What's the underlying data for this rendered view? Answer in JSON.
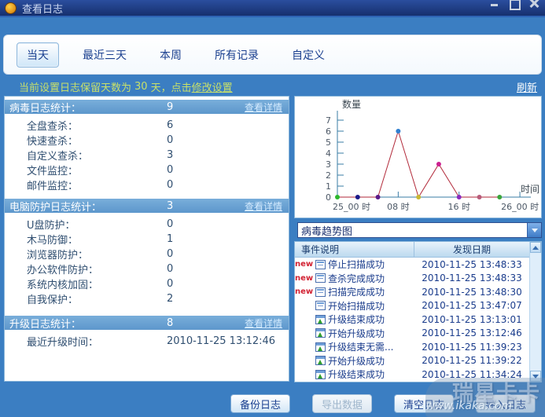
{
  "window": {
    "title": "查看日志"
  },
  "tabs": {
    "items": [
      {
        "label": "当天",
        "active": true
      },
      {
        "label": "最近三天",
        "active": false
      },
      {
        "label": "本周",
        "active": false
      },
      {
        "label": "所有记录",
        "active": false
      },
      {
        "label": "自定义",
        "active": false
      }
    ]
  },
  "notice": {
    "prefix": "当前设置日志保留天数为",
    "days": "30",
    "suffix": "天，点击",
    "link": "修改设置",
    "refresh": "刷新"
  },
  "stats": {
    "sections": [
      {
        "title": "病毒日志统计：",
        "total": "9",
        "detail_link": "查看详情",
        "rows": [
          {
            "label": "全盘查杀：",
            "value": "6"
          },
          {
            "label": "快速查杀：",
            "value": "0"
          },
          {
            "label": "自定义查杀：",
            "value": "3"
          },
          {
            "label": "文件监控：",
            "value": "0"
          },
          {
            "label": "邮件监控：",
            "value": "0"
          }
        ]
      },
      {
        "title": "电脑防护日志统计：",
        "total": "3",
        "detail_link": "查看详情",
        "rows": [
          {
            "label": "U盘防护：",
            "value": "0"
          },
          {
            "label": "木马防御：",
            "value": "1"
          },
          {
            "label": "浏览器防护：",
            "value": "0"
          },
          {
            "label": "办公软件防护：",
            "value": "0"
          },
          {
            "label": "系统内核加固：",
            "value": "0"
          },
          {
            "label": "自我保护：",
            "value": "2"
          }
        ]
      },
      {
        "title": "升级日志统计：",
        "total": "8",
        "detail_link": "查看详情",
        "rows": [
          {
            "label": "最近升级时间：",
            "value": "2010-11-25 13:12:46"
          }
        ]
      }
    ]
  },
  "chart_data": {
    "type": "line",
    "title": "病毒趋势图",
    "xlabel": "时间",
    "ylabel": "数量",
    "ylim": [
      0,
      7
    ],
    "y_ticks": [
      0,
      1,
      2,
      3,
      4,
      5,
      6,
      7
    ],
    "x_tick_hours": [
      0,
      8,
      16,
      24
    ],
    "x_tick_labels": [
      "25_00 时",
      "08 时",
      "16 时",
      "26_00 时"
    ],
    "x_hours": [
      0,
      2.67,
      5.33,
      8,
      10.67,
      13.33,
      16,
      18.67,
      21.33
    ],
    "values": [
      0,
      0,
      0,
      6,
      0,
      3,
      0,
      0,
      0
    ],
    "point_colors": [
      "#2db82d",
      "#1b1b8a",
      "#5a1b8a",
      "#2f7fd0",
      "#c9b832",
      "#cc2090",
      "#8a2bbf",
      "#b85c7a",
      "#3aa53a"
    ],
    "line_color": "#b22a3a",
    "axis_color": "#3a7ca5",
    "grid": false,
    "legend": "none"
  },
  "trend_select": {
    "value": "病毒趋势图"
  },
  "events_table": {
    "headers": [
      "事件说明",
      "发现日期"
    ],
    "new_label": "new",
    "rows": [
      {
        "is_new": true,
        "icon": "log-icon",
        "text": "停止扫描成功",
        "date": "2010-11-25 13:48:33"
      },
      {
        "is_new": true,
        "icon": "log-icon",
        "text": "查杀完成成功",
        "date": "2010-11-25 13:48:33"
      },
      {
        "is_new": true,
        "icon": "log-icon",
        "text": "扫描完成成功",
        "date": "2010-11-25 13:48:30"
      },
      {
        "is_new": false,
        "icon": "log-icon",
        "text": "开始扫描成功",
        "date": "2010-11-25 13:47:07"
      },
      {
        "is_new": false,
        "icon": "upgrade-icon",
        "text": "升级结束成功",
        "date": "2010-11-25 13:13:01"
      },
      {
        "is_new": false,
        "icon": "upgrade-icon",
        "text": "开始升级成功",
        "date": "2010-11-25 13:12:46"
      },
      {
        "is_new": false,
        "icon": "upgrade-icon",
        "text": "升级结束无需...",
        "date": "2010-11-25 11:39:23"
      },
      {
        "is_new": false,
        "icon": "upgrade-icon",
        "text": "开始升级成功",
        "date": "2010-11-25 11:39:22"
      },
      {
        "is_new": false,
        "icon": "upgrade-icon",
        "text": "升级结束成功",
        "date": "2010-11-25 11:34:24"
      }
    ]
  },
  "footer": {
    "buttons": [
      {
        "label": "备份日志",
        "enabled": true
      },
      {
        "label": "导出数据",
        "enabled": false
      },
      {
        "label": "清空日志",
        "enabled": true
      },
      {
        "label": "导入日志",
        "enabled": true
      }
    ]
  },
  "watermark": {
    "brand": "瑞星卡卡",
    "url": "www.ikaka.com"
  },
  "colors": {
    "titlebar": "#1e3c8c",
    "body_blue": "#3b7ec2",
    "section_header": "#68a3d6",
    "notice_text": "#c8e06a",
    "detail_link": "#d6ecff",
    "navy_text": "#1a3f8f",
    "new_badge": "#d22233",
    "upgrade_arrow": "#2e9e2e"
  }
}
